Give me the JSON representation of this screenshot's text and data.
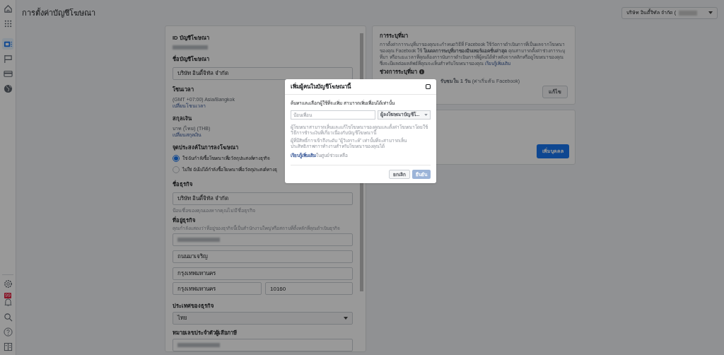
{
  "header": {
    "title": "การตั้งค่าบัญชีโฆษณา",
    "account_switcher": "บริษัท อินดี้จิทัล จำกัด ("
  },
  "sidebar": {
    "top": [
      {
        "kind": "home",
        "selected": false
      },
      {
        "kind": "apps",
        "selected": false
      },
      {
        "kind": "ads",
        "selected": true
      },
      {
        "kind": "flag",
        "selected": false
      },
      {
        "kind": "card",
        "selected": false
      },
      {
        "kind": "globe",
        "selected": false
      }
    ],
    "bottom": [
      {
        "kind": "gear"
      },
      {
        "kind": "bell",
        "badge": "99"
      },
      {
        "kind": "search"
      },
      {
        "kind": "help"
      },
      {
        "kind": "panel"
      }
    ]
  },
  "account": {
    "id_label": "ID บัญชีโฆษณา",
    "name_label": "ชื่อบัญชีโฆษณา",
    "name_value": "บริษัท อินดี้จิทัล จำกัด",
    "timezone_label": "โซนเวลา",
    "timezone_value": "(GMT +07:00) Asia/Bangkok",
    "timezone_link": "เปลี่ยนโซนเวลา",
    "currency_label": "สกุลเงิน",
    "currency_value": "บาท (ไทย) (THB)",
    "currency_link": "เปลี่ยนสกุลเงิน",
    "purpose_label": "จุดประสงค์ในการลงโฆษณา",
    "purpose_options": [
      {
        "label": "ใช่ ฉันกำลังซื้อโฆษณาเพื่อวัตถุประสงค์ทางธุรกิจ",
        "selected": true
      },
      {
        "label": "ไม่ใช่ ฉันไม่ได้กำลังซื้อโฆษณาเพื่อวัตถุประสงค์ทางธุ",
        "selected": false
      }
    ],
    "business_name_label": "ชื่อธุรกิจ",
    "business_name_value": "บริษัท อินดี้จิทัล จำกัด",
    "business_name_hint": "ป้อนชื่อของคุณเองหากคุณไม่มีชื่อธุรกิจ",
    "address_label": "ที่อยู่ธุรกิจ",
    "address_hint": "คุณกำลังแสดงว่าที่อยู่ของธุรกิจนี้เป็นสำนักงานใหญ่หรือสถานที่ตั้งหลักที่คุณดำเนินธุรกิจ",
    "address_lines": [
      "ถนนมาเจริญ",
      "กรุงเทพมหานคร"
    ],
    "city": "กรุงเทพมหานคร",
    "postcode": "10160",
    "country_label": "ประเทศของธุรกิจ",
    "country_value": "ไทย",
    "tax_id_label": "หมายเลขประจำตัวผู้เสียภาษี"
  },
  "attribution": {
    "title": "การระบุที่มา",
    "description": "การตั้งค่าการระบุที่มาของคุณจะกำหนดวิธีที่ Facebook ใช้วัดการดำเนินการที่เป็นผลจากโฆษณาของคุณ Facebook ใช้ **โมเดลการระบุที่มาของอินเทอร์แอคชั่นล่าสุด** คุณสามารถตั้งค่าช่วงการระบุที่มา หรือระยะเวลาที่คุณต้องการนับการดำเนินการที่ผู้คนได้ทำหลังจากคลิกหรือดูโฆษณาของคุณซึ่งจะมีผลต่อผลลัพธ์ที่คุณจะเห็นสำหรับโฆษณาของคุณ",
    "link": "เรียนรู้เพิ่มเติม",
    "window_label": "ช่วงการระบุที่มา",
    "window_value": "**รับชมใน 1 วัน** (ค่าเริ่มต้น Facebook)",
    "edit_button": "แก้ไข"
  },
  "people": {
    "add_button": "เพิ่มบุคคล"
  },
  "dialog": {
    "title": "เพิ่มผู้คนในบัญชีโฆษณานี้",
    "instruction": "ค้นหาและเลือกผู้ใช้ที่จะเพิ่ม สามารถเพิ่มเพื่อนได้เท่านั้น",
    "search_placeholder": "ป้อนเพื่อน",
    "role": "ผู้ลงโฆษณาบัญชีโ...",
    "notes": [
      "ผู้โฆษณาสามารถเห็นและแก้ไขโฆษณาของคุณและตั้งค่าโฆษณาโดยใช้วิธีการชำระเงินที่เกี่ยวเนื่องกับบัญชีโฆษณานี้",
      "ผู้ที่มีสิทธิ์การเข้าถึงระดับ \"ผู้วิเคราะห์\" เท่านั้นที่จะสามารถเห็นประสิทธิภาพการทำงานสำหรับโฆษณาของคุณได้"
    ],
    "help_link": "เรียนรู้เพิ่มเติม",
    "help_suffix": "ในศูนย์ช่วยเหลือ",
    "cancel_button": "ยกเลิก",
    "confirm_button": "ยืนยัน",
    "confirm_disabled": true
  }
}
